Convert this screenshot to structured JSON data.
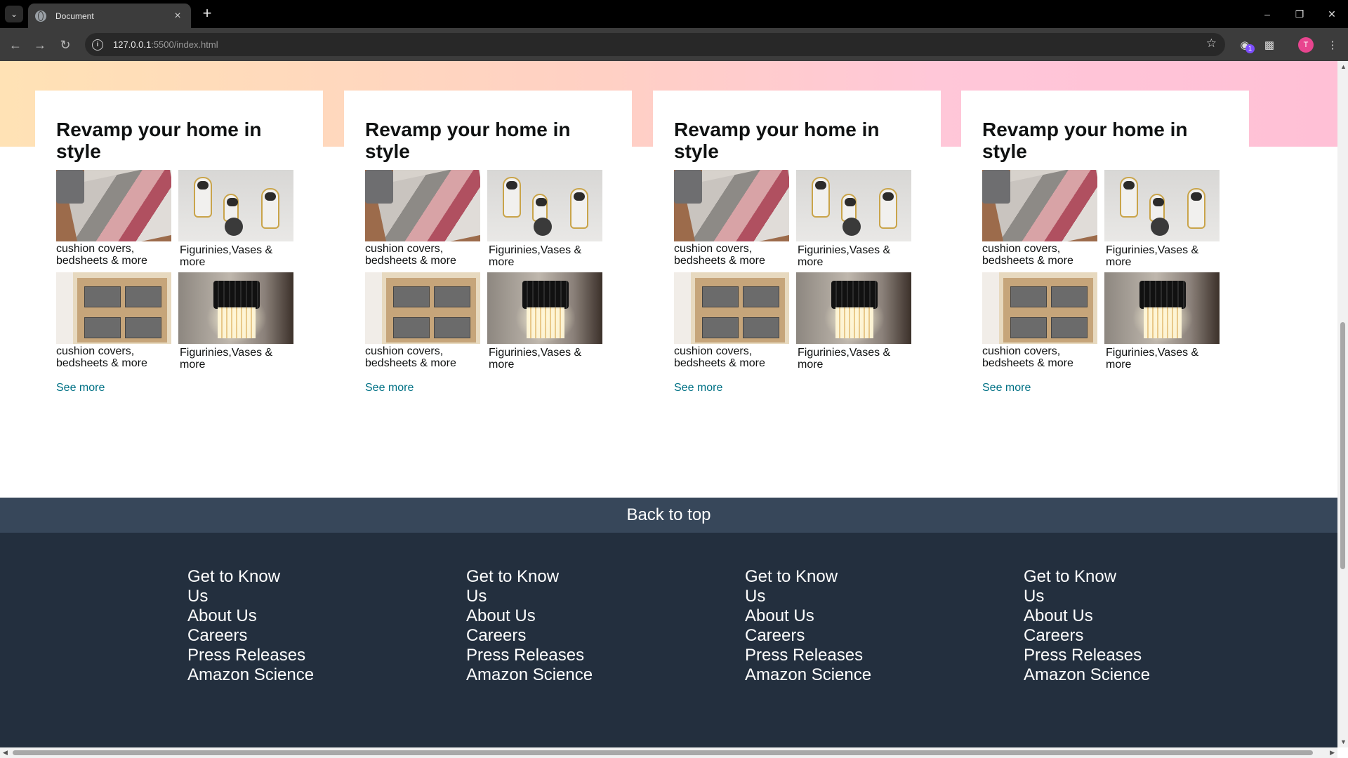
{
  "browser": {
    "tab_title": "Document",
    "tab_close": "×",
    "new_tab": "+",
    "url_host": "127.0.0.1",
    "url_rest": ":5500/index.html",
    "extension_badge": "1",
    "profile_initial": "T"
  },
  "cards": [
    {
      "title": "Revamp your home in style",
      "items": [
        {
          "caption": "cushion covers, bedsheets & more",
          "image": "rug"
        },
        {
          "caption": "Figurinies,Vases & more",
          "image": "astronaut-figurines"
        },
        {
          "caption": "cushion covers, bedsheets & more",
          "image": "shelf-bins"
        },
        {
          "caption": "Figurinies,Vases & more",
          "image": "wall-lamp"
        }
      ],
      "link": "See more"
    },
    {
      "title": "Revamp your home in style",
      "items": [
        {
          "caption": "cushion covers, bedsheets & more",
          "image": "rug"
        },
        {
          "caption": "Figurinies,Vases & more",
          "image": "astronaut-figurines"
        },
        {
          "caption": "cushion covers, bedsheets & more",
          "image": "shelf-bins"
        },
        {
          "caption": "Figurinies,Vases & more",
          "image": "wall-lamp"
        }
      ],
      "link": "See more"
    },
    {
      "title": "Revamp your home in style",
      "items": [
        {
          "caption": "cushion covers, bedsheets & more",
          "image": "rug"
        },
        {
          "caption": "Figurinies,Vases & more",
          "image": "astronaut-figurines"
        },
        {
          "caption": "cushion covers, bedsheets & more",
          "image": "shelf-bins"
        },
        {
          "caption": "Figurinies,Vases & more",
          "image": "wall-lamp"
        }
      ],
      "link": "See more"
    },
    {
      "title": "Revamp your home in style",
      "items": [
        {
          "caption": "cushion covers, bedsheets & more",
          "image": "rug"
        },
        {
          "caption": "Figurinies,Vases & more",
          "image": "astronaut-figurines"
        },
        {
          "caption": "cushion covers, bedsheets & more",
          "image": "shelf-bins"
        },
        {
          "caption": "Figurinies,Vases & more",
          "image": "wall-lamp"
        }
      ],
      "link": "See more"
    }
  ],
  "back_to_top": "Back to top",
  "footer": {
    "columns": [
      {
        "heading": "Get to Know Us",
        "links": [
          "About Us",
          "Careers",
          "Press Releases",
          "Amazon Science"
        ]
      },
      {
        "heading": "Get to Know Us",
        "links": [
          "About Us",
          "Careers",
          "Press Releases",
          "Amazon Science"
        ]
      },
      {
        "heading": "Get to Know Us",
        "links": [
          "About Us",
          "Careers",
          "Press Releases",
          "Amazon Science"
        ]
      },
      {
        "heading": "Get to Know Us",
        "links": [
          "About Us",
          "Careers",
          "Press Releases",
          "Amazon Science"
        ]
      }
    ]
  },
  "colors": {
    "link": "#007185",
    "back_to_top_bg": "#37475a",
    "footer_bg": "#232f3e"
  }
}
